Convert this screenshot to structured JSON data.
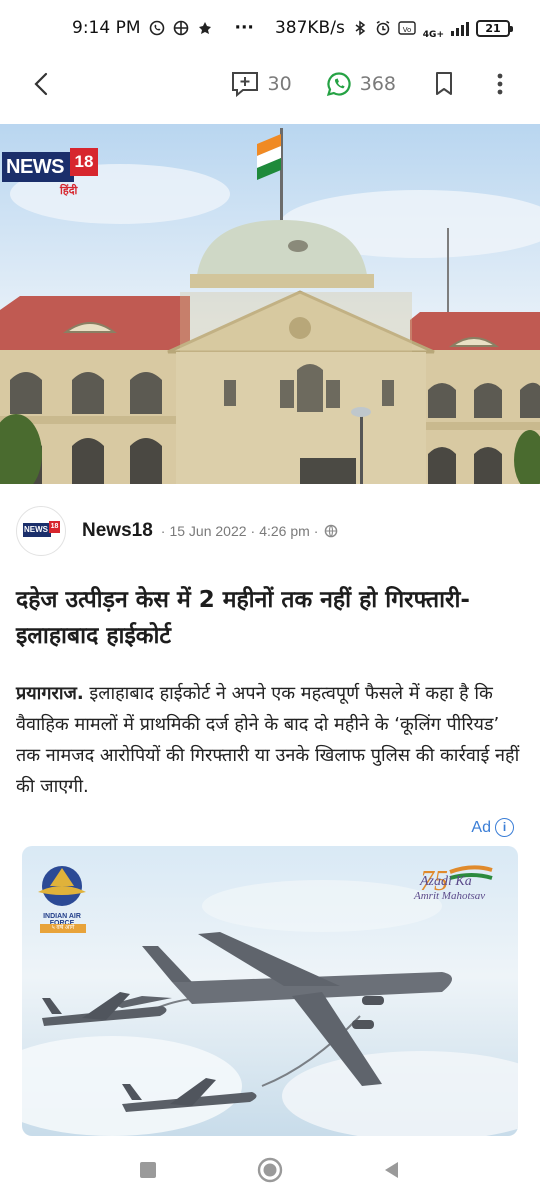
{
  "status_bar": {
    "time": "9:14 PM",
    "more_dots": "···",
    "net_speed": "387KB/s",
    "net_type": "4G+",
    "battery": "21",
    "icons": [
      "whatsapp-icon",
      "app-icon",
      "flower-icon",
      "bluetooth-icon",
      "alarm-icon",
      "volte-icon",
      "signal-icon",
      "battery-icon"
    ]
  },
  "app_bar": {
    "comments_count": "30",
    "share_count": "368",
    "icons": [
      "back-arrow-icon",
      "add-comment-icon",
      "whatsapp-icon",
      "bookmark-icon",
      "more-vertical-icon"
    ]
  },
  "hero_image": {
    "logo_text": "NEWS",
    "logo_badge": "18",
    "logo_sub": "हिंदी"
  },
  "article": {
    "source_name": "News18",
    "source_logo_text": "NEWS",
    "source_logo_badge": "18",
    "date": "15 Jun 2022",
    "time": "4:26 pm",
    "separator": "·",
    "headline": "दहेज उत्पीड़न केस में 2 महीनों तक नहीं हो गिरफ्तारी-इलाहाबाद हाईकोर्ट",
    "dateline": "प्रयागराज.",
    "body": " इलाहाबाद हाईकोर्ट ने अपने एक महत्वपूर्ण फैसले में कहा है कि वैवाहिक मामलों में प्राथमिकी दर्ज होने के बाद दो महीने के ‘कूलिंग पीरियड’ तक नामजद आरोपियों की गिरफ्तारी या उनके खिलाफ पुलिस की कार्रवाई नहीं की जाएगी."
  },
  "ad": {
    "label": "Ad",
    "info_glyph": "i",
    "iaf_text": "INDIAN AIR FORCE",
    "iaf_band": "५ वर्ष आगे",
    "azadi_line1": "Azadi Ka",
    "azadi_line2": "Amrit Mahotsav",
    "azadi_number": "75"
  },
  "colors": {
    "accent_blue": "#3b7ed6",
    "whatsapp_green": "#25a244",
    "news18_red": "#d7262e",
    "news18_navy": "#1b2f6b",
    "muted_text": "#7a7a7a"
  }
}
